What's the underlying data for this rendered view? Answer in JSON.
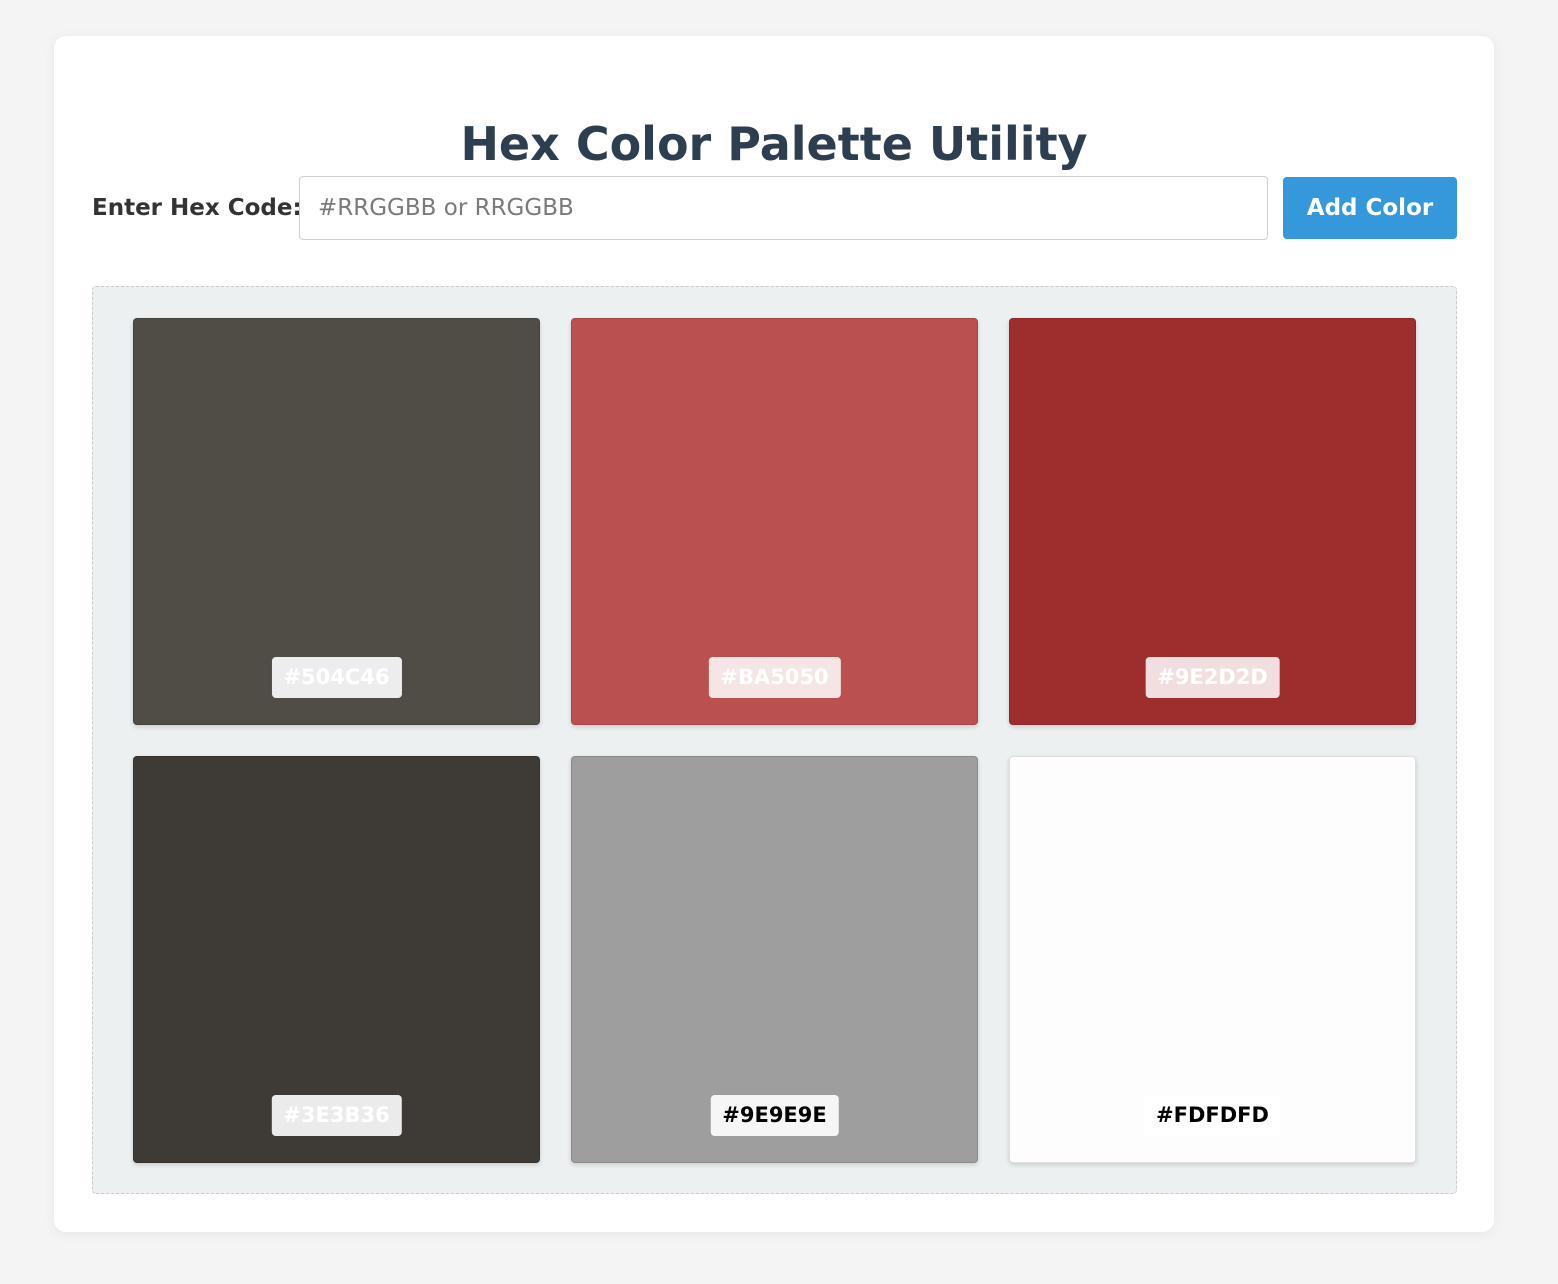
{
  "app": {
    "title": "Hex Color Palette Utility"
  },
  "input": {
    "label": "Enter Hex Code:",
    "value": "",
    "placeholder": "#RRGGBB or RRGGBB",
    "button_label": "Add Color"
  },
  "palette": {
    "swatches": [
      {
        "hex": "#504C46",
        "color": "#504C46",
        "label_bg": "rgba(255,255,255,0.9)",
        "label_fg": "#ffffff"
      },
      {
        "hex": "#BA5050",
        "color": "#BA5050",
        "label_bg": "rgba(255,255,255,0.85)",
        "label_fg": "#ffffff"
      },
      {
        "hex": "#9E2D2D",
        "color": "#9E2D2D",
        "label_bg": "rgba(255,255,255,0.85)",
        "label_fg": "#ffffff"
      },
      {
        "hex": "#3E3B36",
        "color": "#3E3B36",
        "label_bg": "rgba(255,255,255,0.9)",
        "label_fg": "#ffffff"
      },
      {
        "hex": "#9E9E9E",
        "color": "#9E9E9E",
        "label_bg": "rgba(255,255,255,0.9)",
        "label_fg": "#000000"
      },
      {
        "hex": "#FDFDFD",
        "color": "#FDFDFD",
        "label_bg": "rgba(255,255,255,0.9)",
        "label_fg": "#000000"
      }
    ]
  }
}
